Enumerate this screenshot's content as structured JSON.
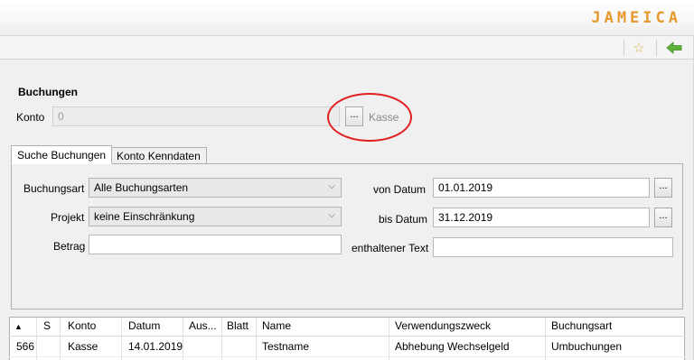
{
  "app": {
    "logo_text": "JAMEICA"
  },
  "toolbar": {
    "bookmark_icon": "star-icon",
    "back_icon": "back-arrow-icon"
  },
  "header": {
    "title": "Buchungen",
    "konto_label": "Konto",
    "konto_value": "0",
    "konto_button": "...",
    "konto_name": "Kasse"
  },
  "tabs": [
    {
      "label": "Suche Buchungen",
      "active": true
    },
    {
      "label": "Konto Kenndaten",
      "active": false
    }
  ],
  "search": {
    "buchungsart_label": "Buchungsart",
    "buchungsart_value": "Alle Buchungsarten",
    "projekt_label": "Projekt",
    "projekt_value": "keine Einschränkung",
    "betrag_label": "Betrag",
    "betrag_value": "",
    "von_label": "von Datum",
    "von_value": "01.01.2019",
    "bis_label": "bis Datum",
    "bis_value": "31.12.2019",
    "text_label": "enthaltener Text",
    "text_value": "",
    "date_button": "..."
  },
  "table": {
    "sort_indicator": "▲",
    "columns": [
      "",
      "S",
      "Konto",
      "Datum",
      "Aus...",
      "Blatt",
      "Name",
      "Verwendungszweck",
      "Buchungsart"
    ],
    "rows": [
      [
        "566",
        "",
        "Kasse",
        "14.01.2019",
        "",
        "",
        "Testname",
        "Abhebung Wechselgeld",
        "Umbuchungen"
      ]
    ]
  },
  "colors": {
    "accent": "#e69a2e",
    "highlight_circle": "#e02020"
  }
}
